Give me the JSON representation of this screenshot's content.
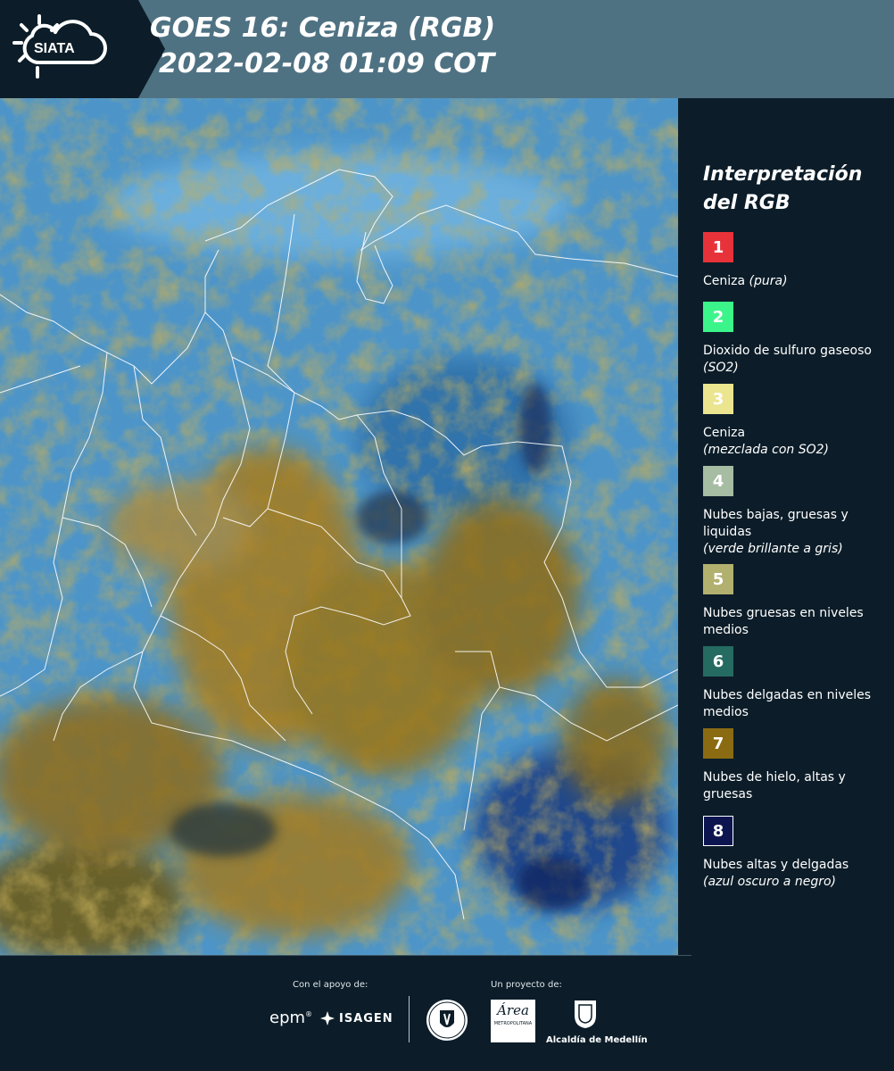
{
  "header": {
    "logo_text": "SIATA",
    "title_line1": "GOES 16: Ceniza (RGB)",
    "title_line2": "2022-02-08 01:09 COT"
  },
  "legend": {
    "title_line1": "Interpretación",
    "title_line2": "del RGB",
    "items": [
      {
        "num": "1",
        "color": "#e8323a",
        "text": "Ceniza",
        "sub": "(pura)",
        "text_color": "#ffffff"
      },
      {
        "num": "2",
        "color": "#3cf58a",
        "text": "Dioxido de sulfuro gaseoso",
        "sub": "(SO2)",
        "text_color": "#ffffff"
      },
      {
        "num": "3",
        "color": "#ece58f",
        "text": "Ceniza",
        "sub": "(mezclada con SO2)",
        "text_color": "#ffffff"
      },
      {
        "num": "4",
        "color": "#a6bca3",
        "text": "Nubes bajas, gruesas y liquidas",
        "sub": "(verde brillante a gris)",
        "text_color": "#ffffff"
      },
      {
        "num": "5",
        "color": "#b2b06e",
        "text": "Nubes gruesas en niveles medios",
        "sub": "",
        "text_color": "#ffffff"
      },
      {
        "num": "6",
        "color": "#256b62",
        "text": "Nubes delgadas en niveles medios",
        "sub": "",
        "text_color": "#ffffff"
      },
      {
        "num": "7",
        "color": "#8a6b12",
        "text": "Nubes de hielo, altas y gruesas",
        "sub": "",
        "text_color": "#ffffff"
      },
      {
        "num": "8",
        "color": "#0d1550",
        "text": "Nubes altas y delgadas",
        "sub": "(azul oscuro a negro)",
        "text_color": "#ffffff"
      }
    ]
  },
  "footer": {
    "support_label": "Con el apoyo de:",
    "project_label": "Un proyecto de:",
    "epm": "epm",
    "isagen": "ISAGEN",
    "area_title": "Área",
    "area_sub": "METROPOLITANA",
    "alcaldia": "Alcaldía de Medellín"
  }
}
